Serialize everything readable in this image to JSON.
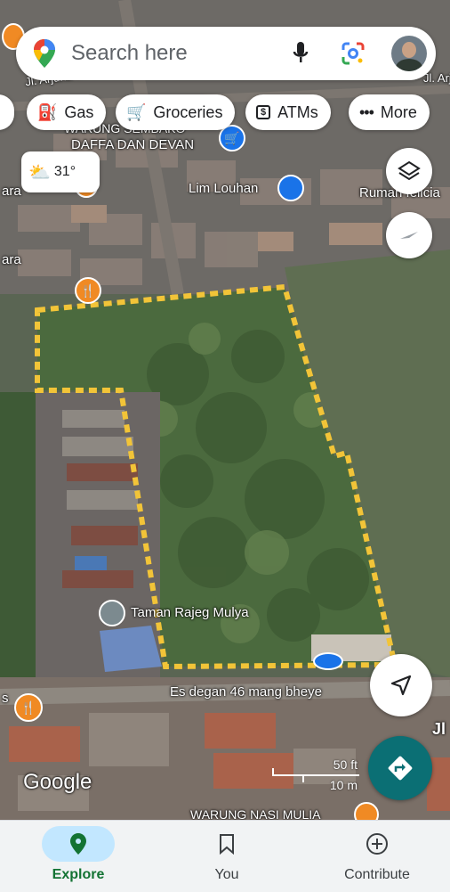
{
  "search": {
    "placeholder": "Search here"
  },
  "chips": [
    {
      "label": "Gas",
      "icon": "gas-station-icon"
    },
    {
      "label": "Groceries",
      "icon": "cart-icon"
    },
    {
      "label": "ATMs",
      "icon": "atm-icon"
    },
    {
      "label": "More",
      "icon": "more-dots-icon"
    }
  ],
  "weather": {
    "temp": "31°",
    "icon": "partly-cloudy-icon"
  },
  "map_labels": {
    "warung_top": "WARUNG SEMBAKO",
    "daffa": "DAFFA DAN DEVAN",
    "lim_louhan": "Lim Louhan",
    "rumah": "Rumah felicia",
    "taman": "Taman Rajeg Mulya",
    "es_degan": "Es degan 46 mang bheye",
    "warung_nasi": "WARUNG NASI MULIA",
    "jl_arjuna_left": "Jl. Arjuna II",
    "jl_arjuna_right": "Jl. Arju",
    "jl_bottom_right": "Jl",
    "ara_top": "ara",
    "ara_mid": "ara",
    "s_left": "s"
  },
  "scale": {
    "ft": "50 ft",
    "m": "10 m"
  },
  "logo": "Google",
  "nav": [
    {
      "label": "Explore",
      "icon": "location-pin-icon",
      "active": true
    },
    {
      "label": "You",
      "icon": "bookmark-icon",
      "active": false
    },
    {
      "label": "Contribute",
      "icon": "plus-circle-icon",
      "active": false
    }
  ],
  "colors": {
    "accent": "#137333",
    "boundary": "#f2c438",
    "nav_active_bg": "#c2e7ff",
    "directions_fab": "#0b6f74"
  }
}
